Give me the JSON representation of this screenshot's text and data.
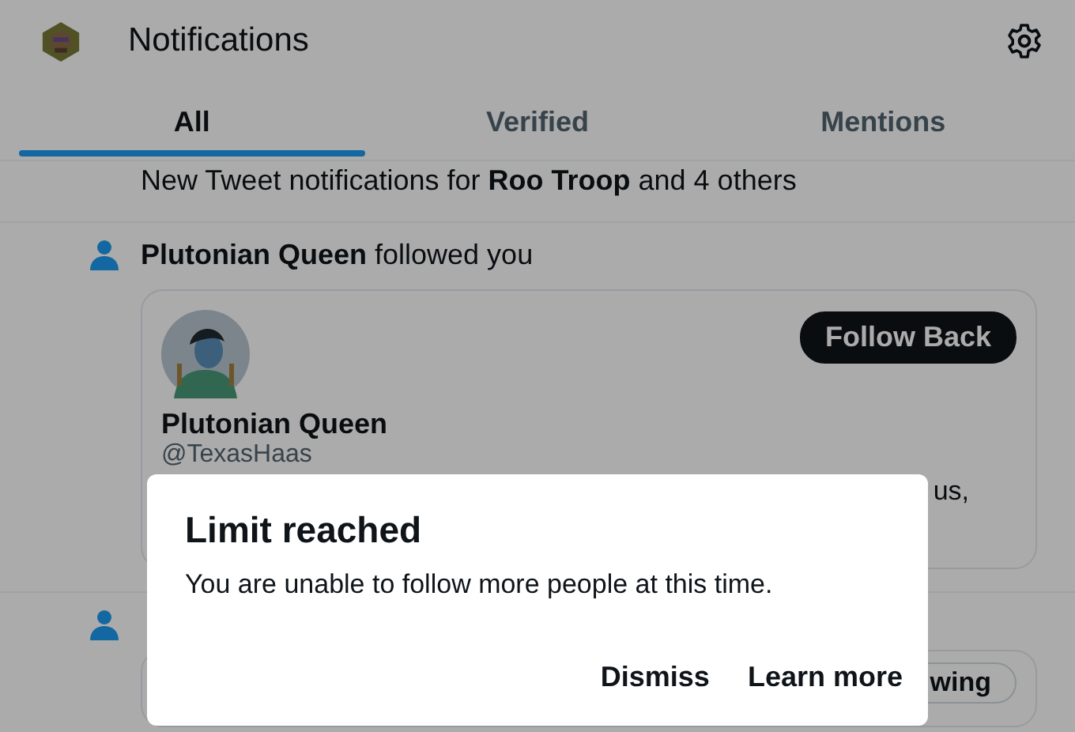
{
  "header": {
    "title": "Notifications"
  },
  "tabs": [
    {
      "label": "All",
      "selected": true
    },
    {
      "label": "Verified",
      "selected": false
    },
    {
      "label": "Mentions",
      "selected": false
    }
  ],
  "subscription_notice": "New Tweet notifications for **Roo Troop** and 4 others",
  "notifications": [
    {
      "text": "**Plutonian Queen** followed you",
      "name": "Plutonian Queen",
      "handle": "@TexasHaas",
      "bio_visible": "us,",
      "button": "Follow Back",
      "following": false
    },
    {
      "button": "wing",
      "following": true
    }
  ],
  "dialog": {
    "title": "Limit reached",
    "message": "You are unable to follow more people at this time.",
    "actions": [
      "Dismiss",
      "Learn more"
    ]
  }
}
